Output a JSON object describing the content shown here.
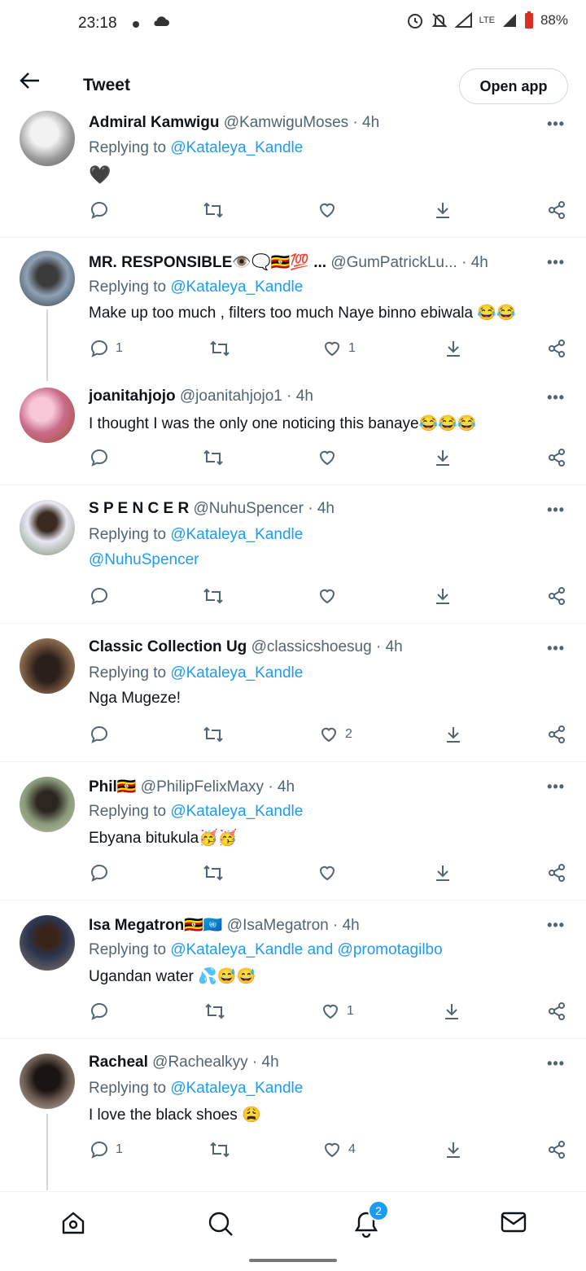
{
  "status": {
    "time": "23:18",
    "battery": "88%",
    "network": "LTE"
  },
  "header": {
    "title": "Tweet",
    "open_app": "Open app"
  },
  "replying_prefix": "Replying to",
  "tweets": [
    {
      "name": "Admiral Kamwigu",
      "handle": "@KamwiguMoses · 4h",
      "reply_to": "@Kataleya_Kandle",
      "body": "🖤",
      "reply_count": "",
      "like_count": ""
    },
    {
      "name": "MR. RESPONSIBLE👁️🗨️🇺🇬💯 ...",
      "handle": "@GumPatrickLu... · 4h",
      "reply_to": "@Kataleya_Kandle",
      "body": "Make up too much , filters too much Naye binno ebiwala 😂😂",
      "reply_count": "1",
      "like_count": "1"
    },
    {
      "name": "joanitahjojo",
      "handle": "@joanitahjojo1 · 4h",
      "reply_to": "",
      "body": "I thought I was the only one noticing this banaye😂😂😂",
      "reply_count": "",
      "like_count": ""
    },
    {
      "name": "S P E N C E R",
      "handle": "@NuhuSpencer · 4h",
      "reply_to": "@Kataleya_Kandle",
      "body": "@NuhuSpencer",
      "reply_count": "",
      "like_count": ""
    },
    {
      "name": "Classic Collection Ug",
      "handle": "@classicshoesug · 4h",
      "reply_to": "@Kataleya_Kandle",
      "body": "Nga Mugeze!",
      "reply_count": "",
      "like_count": "2"
    },
    {
      "name": "Phil🇺🇬",
      "handle": "@PhilipFelixMaxy · 4h",
      "reply_to": "@Kataleya_Kandle",
      "body": "Ebyana bitukula🥳🥳",
      "reply_count": "",
      "like_count": ""
    },
    {
      "name": "Isa Megatron🇺🇬🇺🇳",
      "handle": "@IsaMegatron · 4h",
      "reply_to": "@Kataleya_Kandle and @promotagilbo",
      "body": "Ugandan water 💦😅😅",
      "reply_count": "",
      "like_count": "1"
    },
    {
      "name": "Racheal",
      "handle": "@Rachealkyy · 4h",
      "reply_to": "@Kataleya_Kandle",
      "body": "I love the black shoes 😩",
      "reply_count": "1",
      "like_count": "4"
    }
  ],
  "tabbar": {
    "notifications_badge": "2"
  },
  "colors": {
    "link": "#1d9bf0",
    "secondary": "#536471",
    "divider": "#eff3f4"
  }
}
